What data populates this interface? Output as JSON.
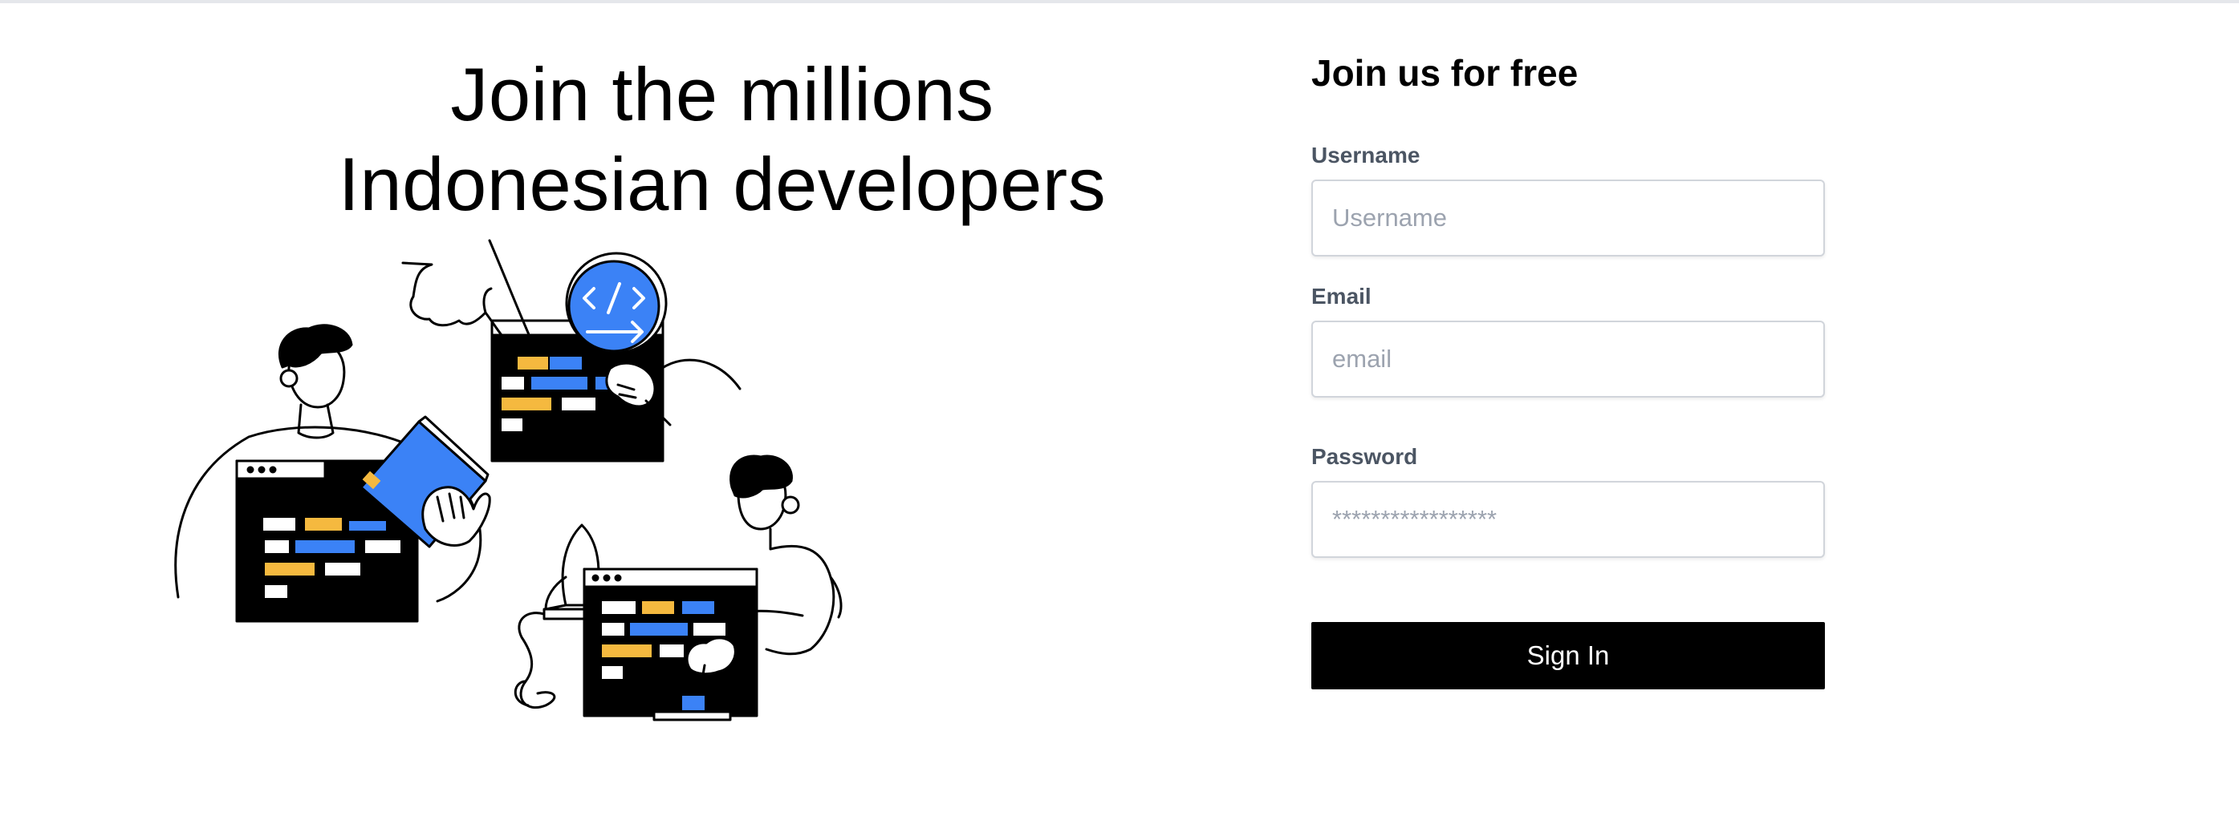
{
  "hero": {
    "title_line1": "Join the millions",
    "title_line2": "Indonesian developers",
    "illustration": "developers-collaborating-illustration"
  },
  "form": {
    "title": "Join us for free",
    "username": {
      "label": "Username",
      "placeholder": "Username",
      "value": ""
    },
    "email": {
      "label": "Email",
      "placeholder": "email",
      "value": ""
    },
    "password": {
      "label": "Password",
      "placeholder": "*****************",
      "value": ""
    },
    "submit_label": "Sign In"
  },
  "colors": {
    "accent_blue": "#3b82f6",
    "accent_yellow": "#f5b93f",
    "button_bg": "#000000",
    "label_gray": "#4b5563",
    "border_gray": "#d1d5db"
  }
}
